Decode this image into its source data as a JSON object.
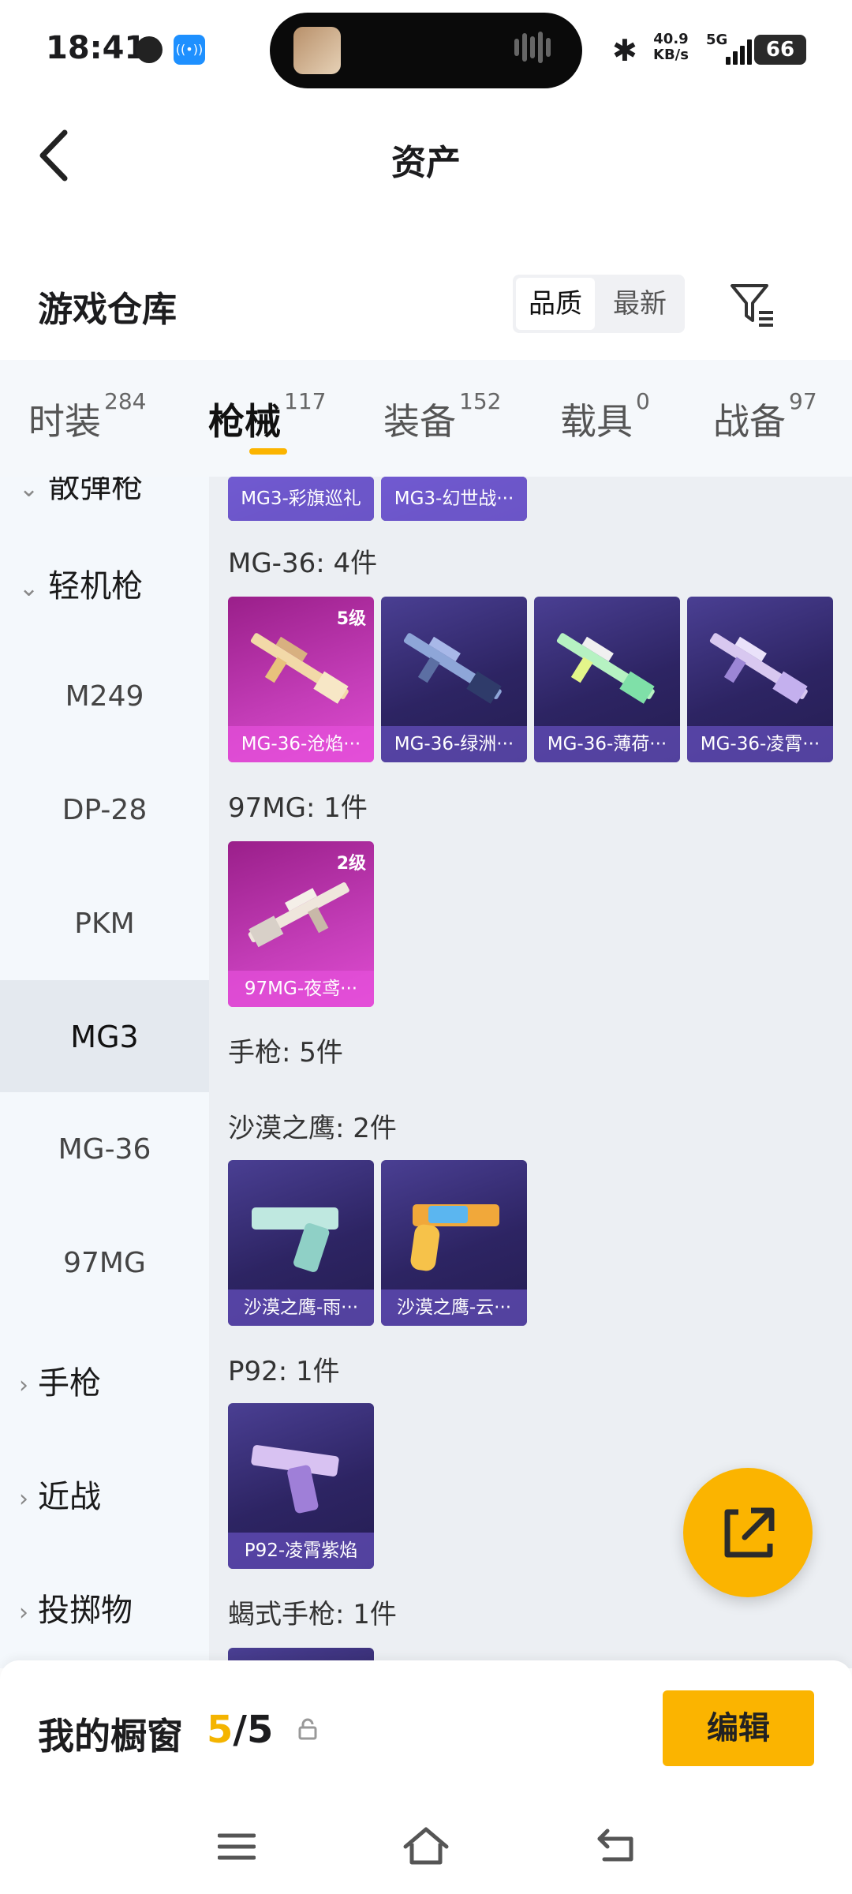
{
  "status": {
    "time": "18:41",
    "net_speed_value": "40.9",
    "net_speed_unit": "KB/s",
    "network": "5G",
    "battery": "66"
  },
  "header": {
    "title": "资产"
  },
  "warehouse": {
    "title": "游戏仓库",
    "sort_options": [
      "品质",
      "最新"
    ],
    "selected_sort": "品质"
  },
  "tabs": [
    {
      "label": "时装",
      "count": "284"
    },
    {
      "label": "枪械",
      "count": "117",
      "active": true
    },
    {
      "label": "装备",
      "count": "152"
    },
    {
      "label": "载具",
      "count": "0"
    },
    {
      "label": "战备",
      "count": "97"
    }
  ],
  "sidebar": {
    "partial_top": "散弹枪",
    "group_lmg": "轻机枪",
    "lmg_items": [
      "M249",
      "DP-28",
      "PKM",
      "MG3",
      "MG-36",
      "97MG"
    ],
    "selected": "MG3",
    "groups_below": [
      "手枪",
      "近战",
      "投掷物"
    ]
  },
  "content": {
    "top_cards": [
      "MG3-彩旗巡礼",
      "MG3-幻世战···"
    ],
    "mg36": {
      "title": "MG-36: 4件",
      "cards": [
        {
          "name": "MG-36-沧焰···",
          "level": "5级"
        },
        {
          "name": "MG-36-绿洲···",
          "level": ""
        },
        {
          "name": "MG-36-薄荷···",
          "level": ""
        },
        {
          "name": "MG-36-凌霄···",
          "level": ""
        }
      ]
    },
    "mg97": {
      "title": "97MG: 1件",
      "cards": [
        {
          "name": "97MG-夜鸢···",
          "level": "2级"
        }
      ]
    },
    "pistol_title": "手枪: 5件",
    "deagle": {
      "title": "沙漠之鹰: 2件",
      "cards": [
        {
          "name": "沙漠之鹰-雨···"
        },
        {
          "name": "沙漠之鹰-云···"
        }
      ]
    },
    "p92": {
      "title": "P92: 1件",
      "cards": [
        {
          "name": "P92-凌霄紫焰"
        }
      ]
    },
    "scorpion": {
      "title": "蝎式手枪: 1件"
    }
  },
  "showcase": {
    "label": "我的橱窗",
    "count_current": "5",
    "count_sep_total": "/5",
    "edit_label": "编辑"
  },
  "colors": {
    "accent": "#fbb400",
    "card_normal": "#2d2463",
    "card_legend": "#c43db8"
  }
}
